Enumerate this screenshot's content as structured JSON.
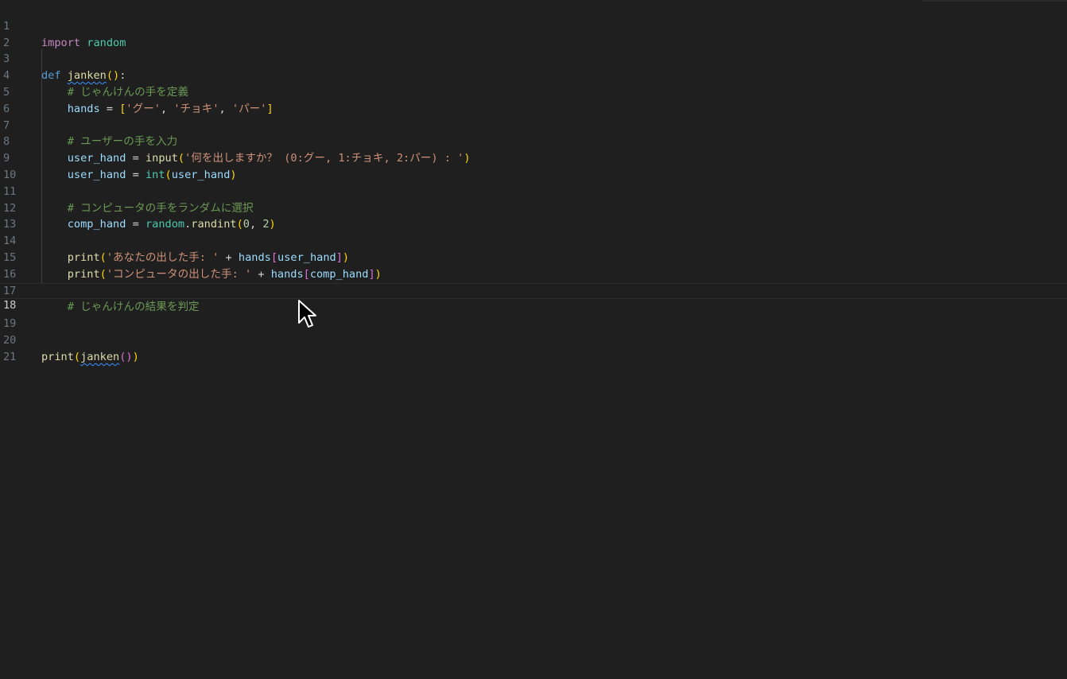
{
  "editor": {
    "language": "python",
    "current_line": 18,
    "line_numbers": [
      "1",
      "2",
      "3",
      "4",
      "5",
      "6",
      "7",
      "8",
      "9",
      "10",
      "11",
      "12",
      "13",
      "14",
      "15",
      "16",
      "17",
      "18",
      "19",
      "20",
      "21"
    ],
    "lines": {
      "l1": {
        "kw": "import",
        "mod": "random"
      },
      "l3": {
        "kw": "def",
        "fn": "janken",
        "p_open": "(",
        "p_close": ")",
        "colon": ":"
      },
      "l4": {
        "comment": "# じゃんけんの手を定義"
      },
      "l5": {
        "var": "hands",
        "eq": " = ",
        "lb": "[",
        "s1": "'グー'",
        "c1": ", ",
        "s2": "'チョキ'",
        "c2": ", ",
        "s3": "'パー'",
        "rb": "]"
      },
      "l7": {
        "comment": "# ユーザーの手を入力"
      },
      "l8": {
        "var": "user_hand",
        "eq": " = ",
        "fn": "input",
        "p_open": "(",
        "str": "'何を出しますか？ (0:グー, 1:チョキ, 2:パー) : '",
        "p_close": ")"
      },
      "l9": {
        "var": "user_hand",
        "eq": " = ",
        "fn": "int",
        "p_open": "(",
        "arg": "user_hand",
        "p_close": ")"
      },
      "l11": {
        "comment": "# コンピュータの手をランダムに選択"
      },
      "l12": {
        "var": "comp_hand",
        "eq": " = ",
        "mod": "random",
        "dot": ".",
        "fn": "randint",
        "p_open": "(",
        "n1": "0",
        "comma": ", ",
        "n2": "2",
        "p_close": ")"
      },
      "l14": {
        "fn": "print",
        "p_open": "(",
        "str": "'あなたの出した手: '",
        "plus": " + ",
        "var": "hands",
        "lb": "[",
        "idx": "user_hand",
        "rb": "]",
        "p_close": ")"
      },
      "l15": {
        "fn": "print",
        "p_open": "(",
        "str": "'コンピュータの出した手: '",
        "plus": " + ",
        "var": "hands",
        "lb": "[",
        "idx": "comp_hand",
        "rb": "]",
        "p_close": ")"
      },
      "l17": {
        "comment": "# じゃんけんの結果を判定"
      },
      "l20": {
        "fn": "print",
        "p_open": "(",
        "inner": "janken",
        "ip_open": "(",
        "ip_close": ")",
        "p_close": ")"
      }
    }
  },
  "icons": {
    "cursor": "mouse-pointer-icon"
  },
  "colors": {
    "background": "#1f1f1f",
    "keyword": "#c586c0",
    "keyword_def": "#569cd6",
    "module": "#4ec9b0",
    "function": "#dcdcaa",
    "variable": "#9cdcfe",
    "string": "#ce9178",
    "number": "#b5cea8",
    "comment": "#6a9955"
  }
}
